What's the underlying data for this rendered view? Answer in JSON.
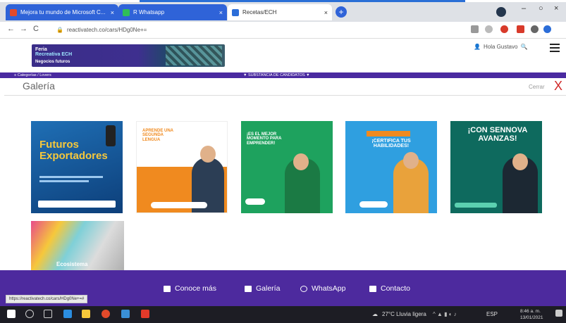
{
  "browser": {
    "tabs": [
      {
        "label": "Mejora tu mundo de Microsoft C...",
        "favicon_color": "#e24a2b"
      },
      {
        "label": "R Whatsapp",
        "favicon_color": "#2fbe5a"
      },
      {
        "label": "Recetas/ECH",
        "favicon_color": "#2b6dd8"
      }
    ],
    "new_tab": "+",
    "window_controls": {
      "minimize": "–",
      "maximize": "○",
      "close": "×"
    },
    "url": "reactivatech.co/cars/HDg0Ne+=",
    "nav": {
      "back": "←",
      "forward": "→",
      "reload": "C"
    }
  },
  "site": {
    "banner": {
      "line1": "Feria",
      "line2": "Recreativa ECH",
      "line3": "Negocios futuros"
    },
    "greeting": "Hola Gustavo",
    "nav_strip": {
      "left": "≡ Categorías / Lovers",
      "center": "▼ SUBSTANCIA DE CANDIDATOS ▼"
    }
  },
  "gallery": {
    "title": "Galería",
    "close_label": "Cerrar",
    "close_icon": "X",
    "items": [
      {
        "title": "Futuros Exportadores",
        "colors": {
          "bg": "#1f6fb5",
          "accent": "#f6c83b"
        }
      },
      {
        "title": "APRENDE UNA SEGUNDA LENGUA",
        "colors": {
          "bg": "#f08a1f"
        }
      },
      {
        "title": "¡ES EL MEJOR MOMENTO PARA EMPRENDER!",
        "colors": {
          "bg": "#1ea25e"
        }
      },
      {
        "title": "¡CERTIFICA TUS HABILIDADES!",
        "colors": {
          "bg": "#2f9fe0"
        }
      },
      {
        "title": "¡CON SENNOVA AVANZAS!",
        "colors": {
          "bg": "#0e6a5e"
        }
      },
      {
        "title": "Ecosistema",
        "colors": {
          "bg": "#e84b8a"
        }
      }
    ]
  },
  "footer": {
    "links": [
      {
        "label": "Conoce más",
        "icon": "list-icon"
      },
      {
        "label": "Galería",
        "icon": "image-icon"
      },
      {
        "label": "WhatsApp",
        "icon": "whatsapp-icon"
      },
      {
        "label": "Contacto",
        "icon": "mail-icon"
      }
    ]
  },
  "status_url": "https://reactivatech.co/cars/HDg0Ne+=#",
  "taskbar": {
    "weather": "27°C Lluvia ligera",
    "lang": "ESP",
    "time": "8:46 a. m.",
    "date": "13/01/2021"
  }
}
